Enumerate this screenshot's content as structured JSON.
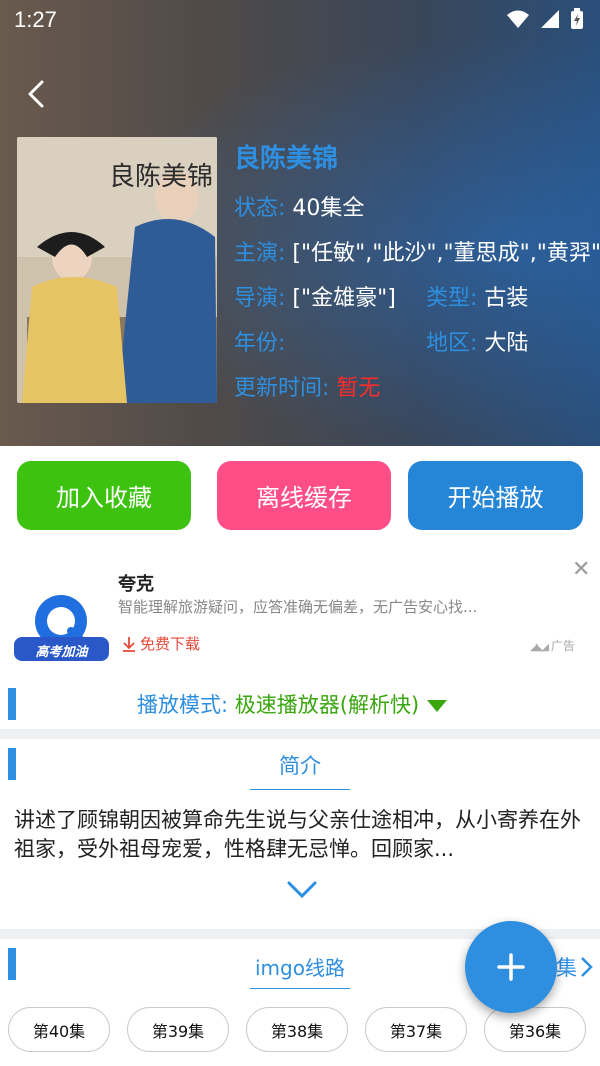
{
  "status_bar": {
    "time": "1:27"
  },
  "drama": {
    "title": "良陈美锦",
    "status_label": "状态:",
    "status_value": "40集全",
    "cast_label": "主演:",
    "cast_value": "[\"任敏\",\"此沙\",\"董思成\",\"黄羿\"]",
    "director_label": "导演:",
    "director_value": "[\"金雄豪\"]",
    "genre_label": "类型:",
    "genre_value": "古装",
    "year_label": "年份:",
    "year_value": "",
    "region_label": "地区:",
    "region_value": "大陆",
    "update_label": "更新时间:",
    "update_value": "暂无",
    "poster_text": "良陈美锦"
  },
  "actions": {
    "favorite": "加入收藏",
    "offline": "离线缓存",
    "play": "开始播放"
  },
  "ad": {
    "title": "夸克",
    "desc": "智能理解旅游疑问，应答准确无偏差，无广告安心找...",
    "download": "免费下载",
    "tag": "广告",
    "logo_badge": "高考加油"
  },
  "player": {
    "mode_label": "播放模式:",
    "mode_value": "极速播放器(解析快)"
  },
  "intro": {
    "title": "简介",
    "text": "讲述了顾锦朝因被算命先生说与父亲仕途相冲，从小寄养在外祖家，受外祖母宠爱，性格肆无忌惮。回顾家..."
  },
  "route": {
    "title": "imgo线路",
    "more": "集"
  },
  "episodes": [
    "第40集",
    "第39集",
    "第38集",
    "第37集",
    "第36集"
  ],
  "colors": {
    "accent": "#2e8fe0",
    "favorite": "#3cc20f",
    "offline": "#ff4d88",
    "play": "#2585d6",
    "update_red": "#ff2a2a",
    "mode_green": "#3aa60f"
  }
}
